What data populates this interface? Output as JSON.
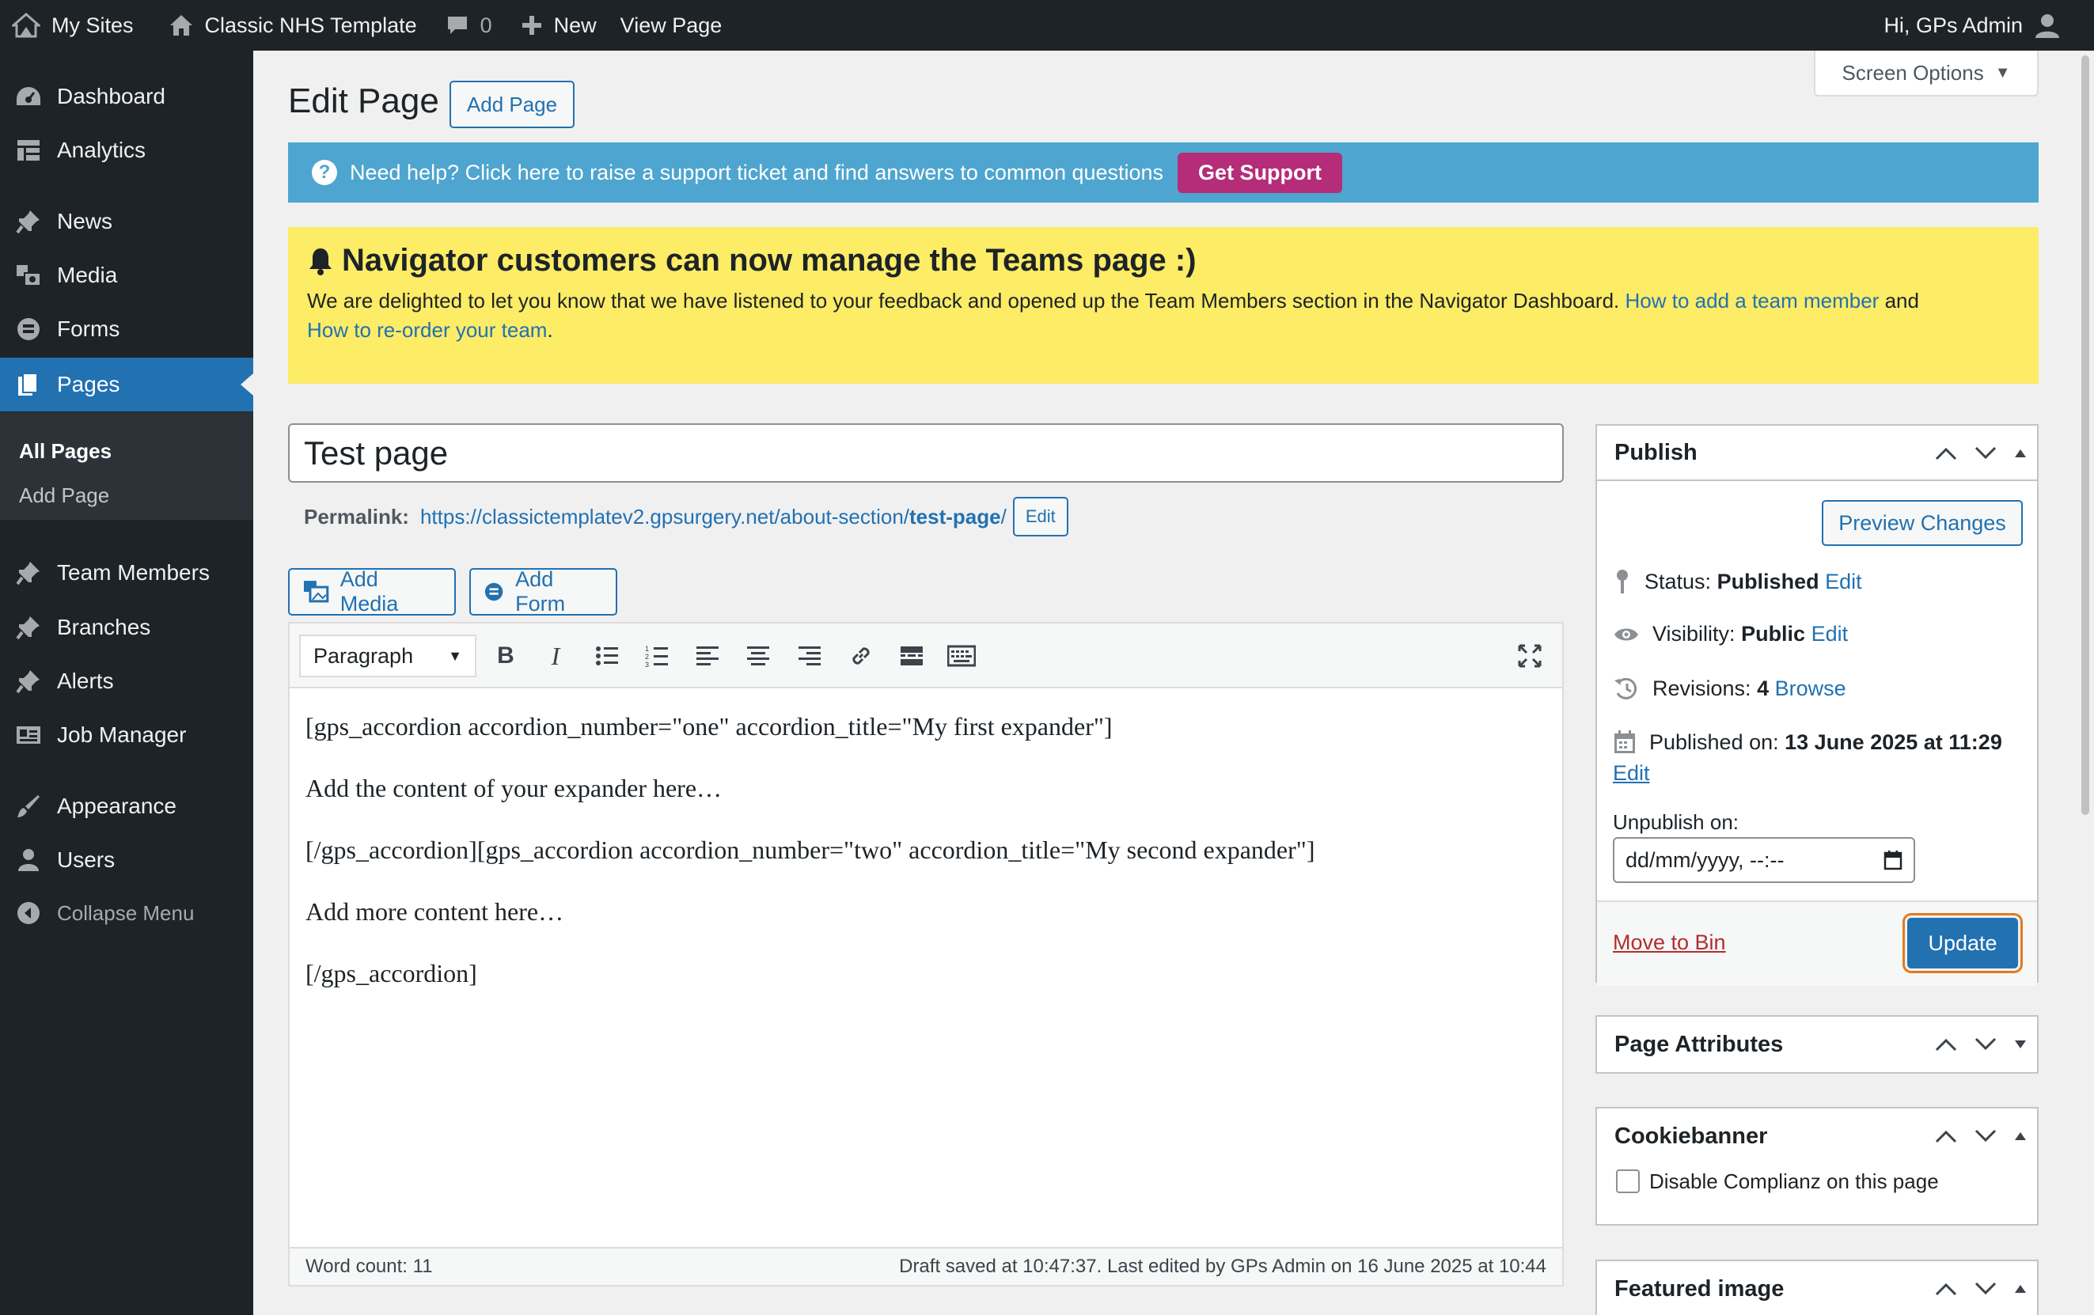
{
  "adminbar": {
    "my_sites": "My Sites",
    "site_name": "Classic NHS Template",
    "comments_count": "0",
    "new_label": "New",
    "view_page": "View Page",
    "greeting": "Hi, GPs Admin"
  },
  "sidebar": {
    "items": [
      {
        "label": "Dashboard",
        "icon": "dashboard-icon"
      },
      {
        "label": "Analytics",
        "icon": "analytics-icon"
      },
      {
        "label": "News",
        "icon": "pin-icon"
      },
      {
        "label": "Media",
        "icon": "media-icon"
      },
      {
        "label": "Forms",
        "icon": "forms-icon"
      },
      {
        "label": "Pages",
        "icon": "pages-icon"
      },
      {
        "label": "Team Members",
        "icon": "pin-icon"
      },
      {
        "label": "Branches",
        "icon": "pin-icon"
      },
      {
        "label": "Alerts",
        "icon": "pin-icon"
      },
      {
        "label": "Job Manager",
        "icon": "job-icon"
      },
      {
        "label": "Appearance",
        "icon": "brush-icon"
      },
      {
        "label": "Users",
        "icon": "users-icon"
      },
      {
        "label": "Collapse Menu",
        "icon": "collapse-icon"
      }
    ],
    "submenu": [
      "All Pages",
      "Add Page"
    ]
  },
  "header": {
    "title": "Edit Page",
    "add_page": "Add Page",
    "screen_options": "Screen Options"
  },
  "help": {
    "text": "Need help? Click here to raise a support ticket and find answers to common questions",
    "button": "Get Support"
  },
  "notice": {
    "title": "Navigator customers can now manage the Teams page :)",
    "body": "We are delighted to let you know that we have listened to your feedback and opened up the Team Members section in the Navigator Dashboard.",
    "link1": "How to add a team member",
    "and": "and",
    "link2": "How to re-order your team",
    "period": "."
  },
  "post": {
    "title": "Test page",
    "permalink_label": "Permalink:",
    "permalink_base": "https://classictemplatev2.gpsurgery.net/about-section/",
    "permalink_slug": "test-page",
    "permalink_end": "/",
    "permalink_edit": "Edit"
  },
  "media": {
    "add_media": "Add Media",
    "add_form": "Add Form"
  },
  "editor": {
    "format": "Paragraph",
    "content": [
      "[gps_accordion accordion_number=\"one\" accordion_title=\"My first expander\"]",
      "Add the content of your expander here…",
      "[/gps_accordion][gps_accordion accordion_number=\"two\" accordion_title=\"My second expander\"]",
      "Add more content here…",
      "[/gps_accordion]"
    ],
    "word_count": "Word count: 11",
    "draft_status": "Draft saved at 10:47:37. Last edited by GPs Admin on 16 June 2025 at 10:44"
  },
  "publish": {
    "title": "Publish",
    "preview": "Preview Changes",
    "status_label": "Status:",
    "status_value": "Published",
    "visibility_label": "Visibility:",
    "visibility_value": "Public",
    "revisions_label": "Revisions:",
    "revisions_value": "4",
    "browse": "Browse",
    "published_label": "Published on:",
    "published_value": "13 June 2025 at 11:29",
    "edit": "Edit",
    "unpublish_label": "Unpublish on:",
    "unpublish_placeholder": "dd/mm/yyyy, --:--",
    "move_to_bin": "Move to Bin",
    "update": "Update"
  },
  "boxes": {
    "page_attributes": "Page Attributes",
    "cookiebanner": "Cookiebanner",
    "cookie_checkbox": "Disable Complianz on this page",
    "featured_image": "Featured image"
  },
  "colors": {
    "accent": "#2271b1",
    "adminbar": "#1d2327",
    "help_bg": "#4ea5cf",
    "support": "#b52c78",
    "notice_bg": "#fcec66"
  }
}
